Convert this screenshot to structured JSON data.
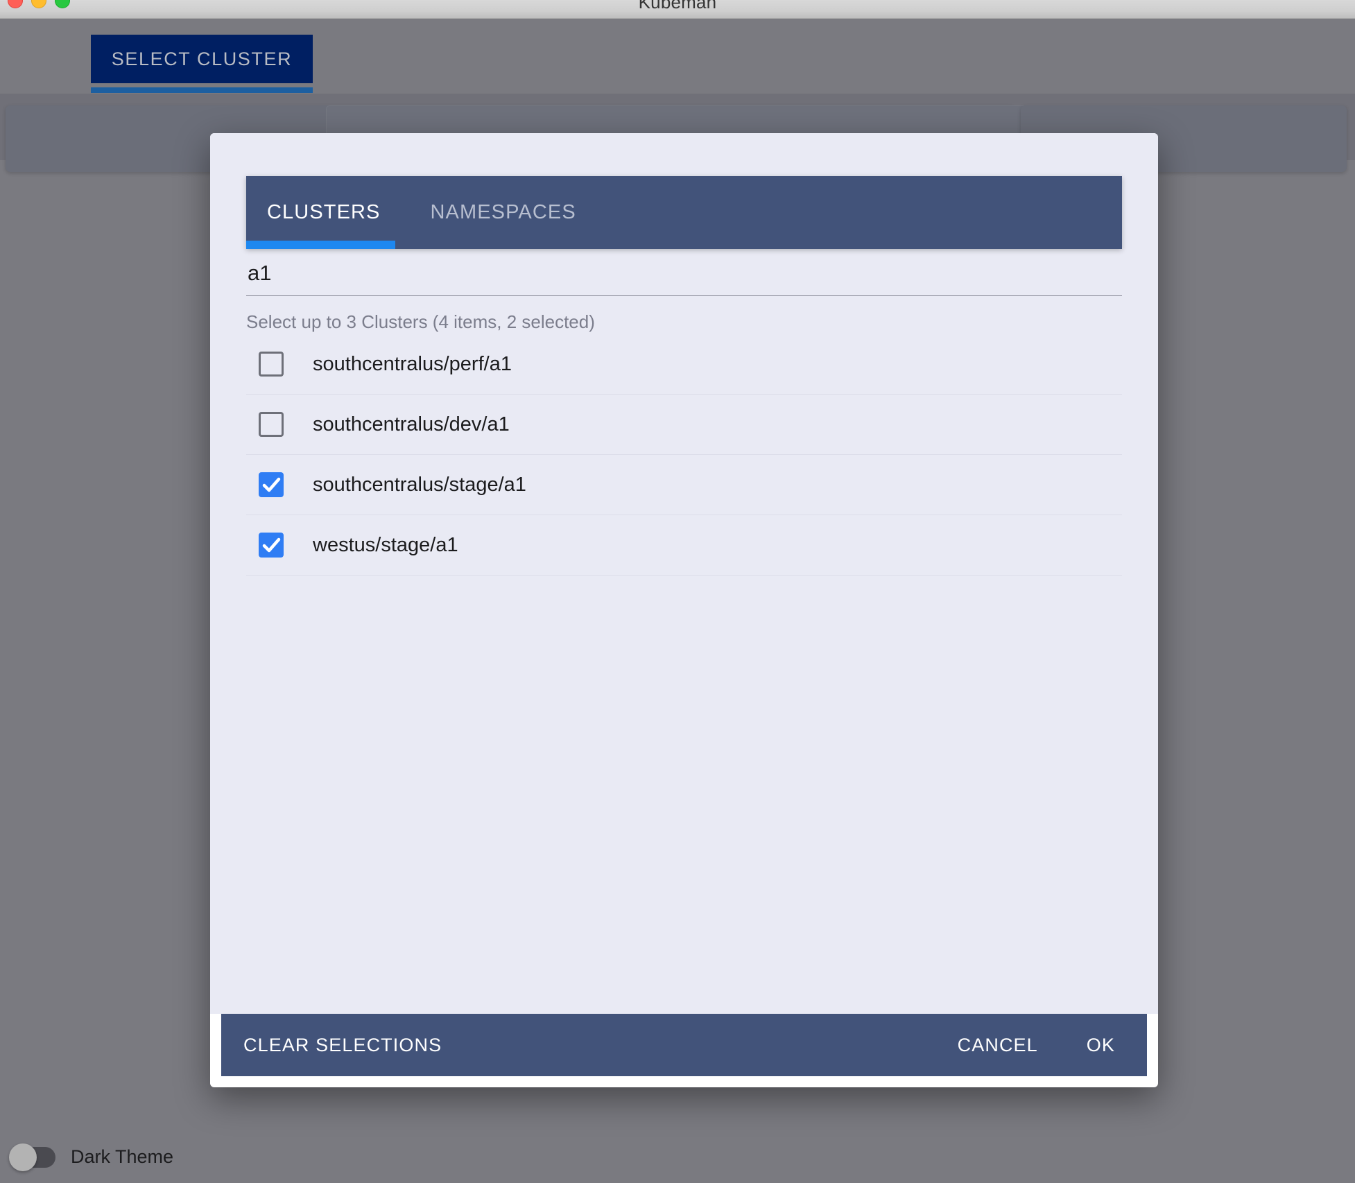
{
  "window": {
    "title": "Kubeman",
    "traffic_lights": [
      "close",
      "minimize",
      "zoom"
    ]
  },
  "app": {
    "select_cluster_button": "SELECT CLUSTER",
    "dark_theme_label": "Dark Theme",
    "dark_theme_enabled": false
  },
  "dialog": {
    "tabs": [
      {
        "label": "CLUSTERS",
        "active": true
      },
      {
        "label": "NAMESPACES",
        "active": false
      }
    ],
    "search": {
      "value": "a1",
      "placeholder": ""
    },
    "helper_text": "Select up to 3 Clusters (4 items, 2 selected)",
    "max_selectable": 3,
    "item_count": 4,
    "selected_count": 2,
    "items": [
      {
        "label": "southcentralus/perf/a1",
        "checked": false
      },
      {
        "label": "southcentralus/dev/a1",
        "checked": false
      },
      {
        "label": "southcentralus/stage/a1",
        "checked": true
      },
      {
        "label": "westus/stage/a1",
        "checked": true
      }
    ],
    "footer": {
      "clear": "CLEAR SELECTIONS",
      "cancel": "CANCEL",
      "ok": "OK"
    }
  },
  "colors": {
    "accent_blue": "#2f7df4",
    "tab_indicator": "#1e88f0",
    "header_bar": "#42537a",
    "dialog_bg": "#e9eaf4",
    "select_cluster_bg": "#001f62"
  }
}
